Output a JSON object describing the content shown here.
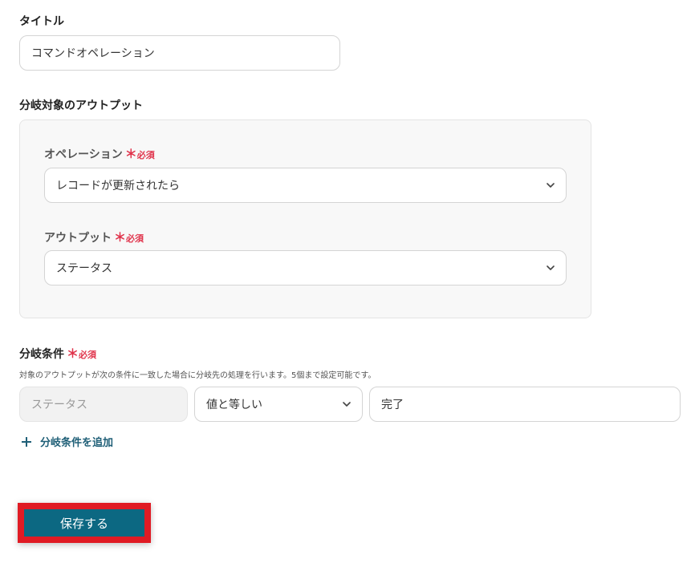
{
  "title_section": {
    "label": "タイトル",
    "value": "コマンドオペレーション"
  },
  "branch_target": {
    "label": "分岐対象のアウトプット",
    "operation": {
      "label": "オペレーション",
      "required_mark": "＊",
      "required_text": "必須",
      "value": "レコードが更新されたら",
      "icon": "chevron-down-icon"
    },
    "output": {
      "label": "アウトプット",
      "required_mark": "＊",
      "required_text": "必須",
      "value": "ステータス",
      "icon": "chevron-down-icon"
    }
  },
  "condition": {
    "label": "分岐条件",
    "required_mark": "＊",
    "required_text": "必須",
    "help": "対象のアウトプットが次の条件に一致した場合に分岐先の処理を行います。5個まで設定可能です。",
    "field_value": "ステータス",
    "operator": "値と等しい",
    "compare_value": "完了",
    "add_icon": "plus-icon",
    "add_label": "分岐条件を追加"
  },
  "save": {
    "label": "保存する"
  },
  "colors": {
    "required": "#e0334b",
    "accent": "#0c6882",
    "link": "#1f5f77",
    "highlight": "#e01b24"
  }
}
